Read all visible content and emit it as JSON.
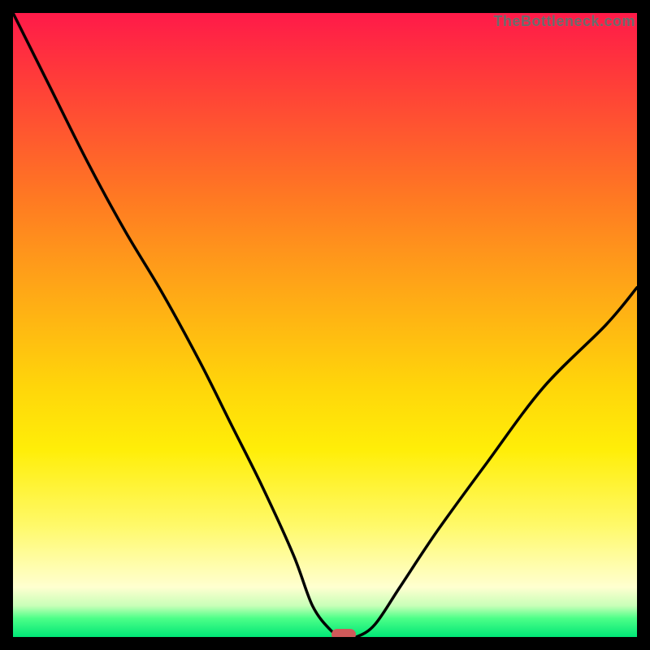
{
  "attribution": "TheBottleneck.com",
  "chart_data": {
    "type": "line",
    "title": "",
    "xlabel": "",
    "ylabel": "",
    "xlim": [
      0,
      100
    ],
    "ylim": [
      0,
      100
    ],
    "grid": false,
    "series": [
      {
        "name": "curve",
        "x": [
          0,
          6,
          12,
          18,
          24,
          30,
          35,
          40,
          45,
          48,
          51,
          53,
          55,
          58,
          62,
          68,
          76,
          85,
          95,
          100
        ],
        "y": [
          100,
          88,
          76,
          65,
          55,
          44,
          34,
          24,
          13,
          5,
          1,
          0,
          0,
          2,
          8,
          17,
          28,
          40,
          50,
          56
        ]
      }
    ],
    "marker": {
      "x": 53,
      "y": 0
    },
    "background_gradient": {
      "top": "#ff1a49",
      "middle": "#ffd60a",
      "bottom": "#00e676"
    },
    "colors": {
      "curve": "#000000",
      "marker_fill": "#cf5a5a"
    }
  }
}
